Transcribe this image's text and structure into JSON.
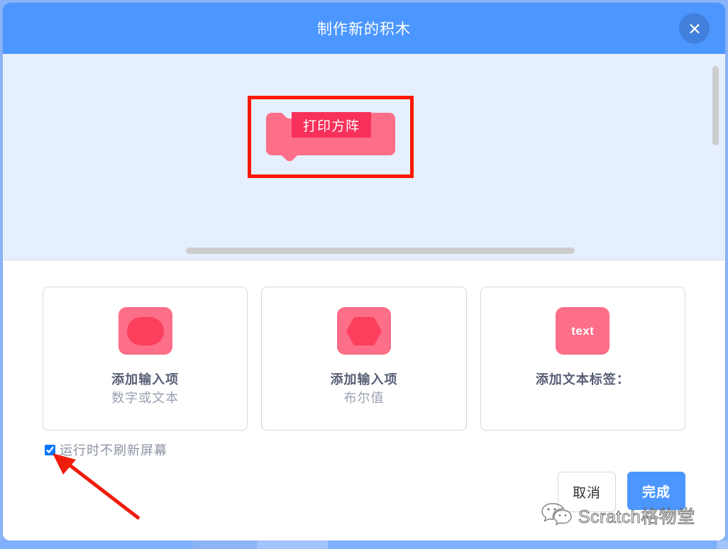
{
  "modal": {
    "title": "制作新的积木",
    "close_icon": "close-icon"
  },
  "workspace": {
    "block": {
      "label": "打印方阵",
      "block_color": "#fd6e88",
      "field_color": "#f8315a",
      "annotation_color": "#fb1700"
    },
    "scrollbars": {
      "horizontal": "horizontal-scrollbar",
      "vertical": "vertical-scrollbar"
    },
    "background_color": "#e6effd"
  },
  "options": [
    {
      "icon": "oval-input-icon",
      "icon_text": "",
      "title": "添加输入项",
      "subtitle": "数字或文本"
    },
    {
      "icon": "boolean-input-icon",
      "icon_text": "",
      "title": "添加输入项",
      "subtitle": "布尔值"
    },
    {
      "icon": "text-label-icon",
      "icon_text": "text",
      "title": "添加文本标签：",
      "subtitle": ""
    }
  ],
  "checkbox": {
    "label": "运行时不刷新屏幕",
    "checked": true
  },
  "footer": {
    "cancel_label": "取消",
    "ok_label": "完成"
  },
  "watermark": {
    "text": "Scratch格物堂",
    "icon": "wechat-icon"
  },
  "theme": {
    "header_blue": "#4c97ff",
    "close_circle": "#4280dd",
    "primary_text": "#575e75",
    "secondary_text": "#9aa0b0",
    "card_border": "#d5d8de",
    "scrollbar": "#cdcdcd"
  }
}
